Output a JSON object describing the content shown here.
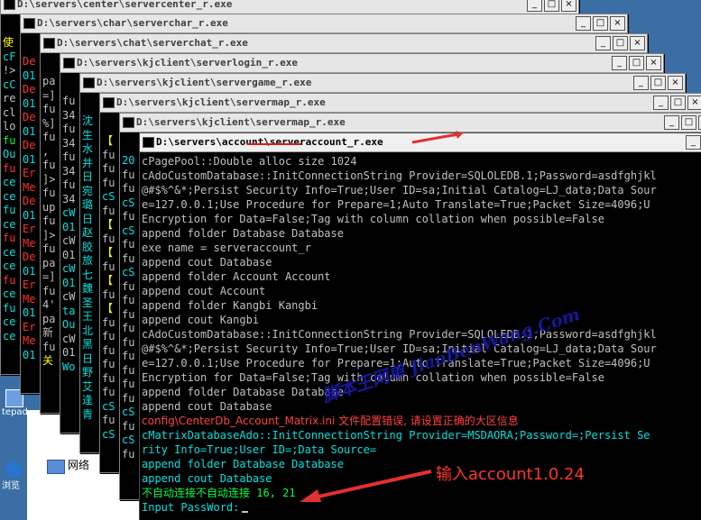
{
  "windows": [
    {
      "title": "D:\\servers\\center\\servercenter_r.exe",
      "lines": [
        {
          "t": "使",
          "c": "y"
        },
        {
          "t": "cF",
          "c": "c"
        },
        {
          "t": "!>",
          "c": "g"
        },
        {
          "t": "cC",
          "c": "c"
        },
        {
          "t": "re",
          "c": "g"
        },
        {
          "t": "cl",
          "c": "g"
        },
        {
          "t": "lo",
          "c": "g"
        },
        {
          "t": "fu",
          "c": "gr"
        },
        {
          "t": "Ou",
          "c": "c"
        },
        {
          "t": "",
          "c": "g"
        },
        {
          "t": "fu",
          "c": "r"
        },
        {
          "t": "ce",
          "c": "c"
        },
        {
          "t": "ce",
          "c": "c"
        },
        {
          "t": "fu",
          "c": "c"
        },
        {
          "t": "ce",
          "c": "c"
        },
        {
          "t": "fu",
          "c": "r"
        },
        {
          "t": "ce",
          "c": "c"
        },
        {
          "t": "ce",
          "c": "c"
        },
        {
          "t": "fu",
          "c": "r"
        },
        {
          "t": "ce",
          "c": "c"
        },
        {
          "t": "fu",
          "c": "c"
        },
        {
          "t": "ce",
          "c": "c"
        },
        {
          "t": "ce",
          "c": "c"
        }
      ]
    },
    {
      "title": "D:\\servers\\char\\serverchar_r.exe",
      "lines": [
        {
          "t": "De",
          "c": "r"
        },
        {
          "t": "01",
          "c": "c"
        },
        {
          "t": "De",
          "c": "r"
        },
        {
          "t": "01",
          "c": "c"
        },
        {
          "t": "De",
          "c": "r"
        },
        {
          "t": "01",
          "c": "c"
        },
        {
          "t": "De",
          "c": "r"
        },
        {
          "t": "01",
          "c": "c"
        },
        {
          "t": "Er",
          "c": "r"
        },
        {
          "t": "Me",
          "c": "r"
        },
        {
          "t": "De",
          "c": "r"
        },
        {
          "t": "01",
          "c": "c"
        },
        {
          "t": "Er",
          "c": "r"
        },
        {
          "t": "Me",
          "c": "r"
        },
        {
          "t": "De",
          "c": "r"
        },
        {
          "t": "01",
          "c": "c"
        },
        {
          "t": "Er",
          "c": "r"
        },
        {
          "t": "Me",
          "c": "r"
        },
        {
          "t": "01",
          "c": "c"
        },
        {
          "t": "Er",
          "c": "r"
        },
        {
          "t": "Me",
          "c": "r"
        },
        {
          "t": "01",
          "c": "c"
        }
      ]
    },
    {
      "title": "D:\\servers\\chat\\serverchat_r.exe",
      "lines": [
        {
          "t": "pa",
          "c": "g"
        },
        {
          "t": "=]",
          "c": "g"
        },
        {
          "t": "fu",
          "c": "g"
        },
        {
          "t": "%]",
          "c": "g"
        },
        {
          "t": "fu",
          "c": "g"
        },
        {
          "t": ",",
          "c": "g"
        },
        {
          "t": "fu",
          "c": "g"
        },
        {
          "t": "]>",
          "c": "g"
        },
        {
          "t": "fu",
          "c": "g"
        },
        {
          "t": "up",
          "c": "g"
        },
        {
          "t": "fu",
          "c": "g"
        },
        {
          "t": "]>",
          "c": "g"
        },
        {
          "t": "fu",
          "c": "g"
        },
        {
          "t": "pa",
          "c": "g"
        },
        {
          "t": "=]",
          "c": "g"
        },
        {
          "t": "fu",
          "c": "g"
        },
        {
          "t": "4'",
          "c": "g"
        },
        {
          "t": "pa",
          "c": "g"
        },
        {
          "t": "新",
          "c": "g"
        },
        {
          "t": "fu",
          "c": "g"
        },
        {
          "t": "关",
          "c": "y"
        }
      ]
    },
    {
      "title": "D:\\servers\\kjclient\\serverlogin_r.exe",
      "lines": [
        {
          "t": "fu",
          "c": "g"
        },
        {
          "t": "34",
          "c": "g"
        },
        {
          "t": "fu",
          "c": "g"
        },
        {
          "t": "34",
          "c": "g"
        },
        {
          "t": "fu",
          "c": "g"
        },
        {
          "t": "34",
          "c": "g"
        },
        {
          "t": "fu",
          "c": "g"
        },
        {
          "t": "34",
          "c": "g"
        },
        {
          "t": "cW",
          "c": "c"
        },
        {
          "t": "01",
          "c": "c"
        },
        {
          "t": "cW",
          "c": "g"
        },
        {
          "t": "01",
          "c": "g"
        },
        {
          "t": "cW",
          "c": "c"
        },
        {
          "t": "01",
          "c": "c"
        },
        {
          "t": "cW",
          "c": "g"
        },
        {
          "t": "ta",
          "c": "c"
        },
        {
          "t": "Ou",
          "c": "c"
        },
        {
          "t": "cW",
          "c": "g"
        },
        {
          "t": "01",
          "c": "g"
        },
        {
          "t": "Wo",
          "c": "c"
        }
      ]
    },
    {
      "title": "D:\\servers\\kjclient\\servergame_r.exe",
      "lines": [
        {
          "t": "沈",
          "c": "c"
        },
        {
          "t": "生",
          "c": "c"
        },
        {
          "t": "水",
          "c": "c"
        },
        {
          "t": "井",
          "c": "c"
        },
        {
          "t": "日",
          "c": "c"
        },
        {
          "t": "宛",
          "c": "c"
        },
        {
          "t": "璐",
          "c": "c"
        },
        {
          "t": "日",
          "c": "c"
        },
        {
          "t": "赵",
          "c": "c"
        },
        {
          "t": "胶",
          "c": "c"
        },
        {
          "t": "旅",
          "c": "c"
        },
        {
          "t": "七",
          "c": "c"
        },
        {
          "t": "魏",
          "c": "c"
        },
        {
          "t": "圣",
          "c": "c"
        },
        {
          "t": "王",
          "c": "c"
        },
        {
          "t": "北",
          "c": "c"
        },
        {
          "t": "黑",
          "c": "c"
        },
        {
          "t": "日",
          "c": "c"
        },
        {
          "t": "野",
          "c": "c"
        },
        {
          "t": "艾",
          "c": "c"
        },
        {
          "t": "逢",
          "c": "c"
        },
        {
          "t": "青",
          "c": "c"
        }
      ]
    },
    {
      "title": "D:\\servers\\kjclient\\servermap_r.exe",
      "lines": [
        {
          "t": "【",
          "c": "y"
        },
        {
          "t": "fu",
          "c": "g"
        },
        {
          "t": "fu",
          "c": "g"
        },
        {
          "t": "fu",
          "c": "g"
        },
        {
          "t": "cS",
          "c": "c"
        },
        {
          "t": "fu",
          "c": "g"
        },
        {
          "t": "【",
          "c": "y"
        },
        {
          "t": "fu",
          "c": "g"
        },
        {
          "t": "【",
          "c": "y"
        },
        {
          "t": "fu",
          "c": "g"
        },
        {
          "t": "【",
          "c": "y"
        },
        {
          "t": "fu",
          "c": "g"
        },
        {
          "t": "【",
          "c": "y"
        },
        {
          "t": "fu",
          "c": "g"
        },
        {
          "t": "fu",
          "c": "g"
        },
        {
          "t": "fu",
          "c": "g"
        },
        {
          "t": "fu",
          "c": "g"
        },
        {
          "t": "fu",
          "c": "g"
        },
        {
          "t": "fu",
          "c": "g"
        },
        {
          "t": "cS",
          "c": "c"
        },
        {
          "t": "fu",
          "c": "g"
        },
        {
          "t": "cS",
          "c": "c"
        }
      ]
    },
    {
      "title": "D:\\servers\\kjclient\\servermap_r.exe",
      "lines": [
        {
          "t": "20",
          "c": "c"
        },
        {
          "t": "fu",
          "c": "g"
        },
        {
          "t": "fu",
          "c": "g"
        },
        {
          "t": "cS",
          "c": "c"
        },
        {
          "t": "fu",
          "c": "g"
        },
        {
          "t": "cS",
          "c": "c"
        },
        {
          "t": "fu",
          "c": "g"
        },
        {
          "t": "fu",
          "c": "g"
        },
        {
          "t": "cS",
          "c": "c"
        },
        {
          "t": "fu",
          "c": "g"
        },
        {
          "t": "fu",
          "c": "g"
        },
        {
          "t": "fu",
          "c": "g"
        },
        {
          "t": "fu",
          "c": "g"
        },
        {
          "t": "fu",
          "c": "g"
        },
        {
          "t": "fu",
          "c": "g"
        },
        {
          "t": "fu",
          "c": "g"
        },
        {
          "t": "fu",
          "c": "g"
        },
        {
          "t": "fu",
          "c": "g"
        },
        {
          "t": "cS",
          "c": "c"
        },
        {
          "t": "fu",
          "c": "g"
        },
        {
          "t": "cS",
          "c": "c"
        },
        {
          "t": "fu",
          "c": "g"
        }
      ]
    }
  ],
  "main_window": {
    "title": "D:\\servers\\account\\serveraccount_r.exe",
    "lines": [
      {
        "t": "cPagePool::Double alloc size 1024",
        "c": "g"
      },
      {
        "t": "cAdoCustomDatabase::InitConnectionString Provider=SQLOLEDB.1;Password=asdfghjkl",
        "c": "g"
      },
      {
        "t": "@#$%^&*;Persist Security Info=True;User ID=sa;Initial Catalog=LJ_data;Data Sour",
        "c": "g"
      },
      {
        "t": "e=127.0.0.1;Use Procedure for Prepare=1;Auto Translate=True;Packet Size=4096;U",
        "c": "g"
      },
      {
        "t": " Encryption for Data=False;Tag with column collation when possible=False",
        "c": "g"
      },
      {
        "t": "append folder Database Database",
        "c": "g"
      },
      {
        "t": "exe name = serveraccount_r",
        "c": "g"
      },
      {
        "t": "append cout Database",
        "c": "g"
      },
      {
        "t": "append folder Account Account",
        "c": "g"
      },
      {
        "t": "append cout Account",
        "c": "g"
      },
      {
        "t": "append folder Kangbi Kangbi",
        "c": "g"
      },
      {
        "t": "append cout Kangbi",
        "c": "g"
      },
      {
        "t": "cAdoCustomDatabase::InitConnectionString Provider=SQLOLEDB.1;Password=asdfghjkl",
        "c": "g"
      },
      {
        "t": "@#$%^&*;Persist Security Info=True;User ID=sa;Initial Catalog=LJ_data;Data Sour",
        "c": "g"
      },
      {
        "t": "e=127.0.0.1;Use Procedure for Prepare=1;Auto Translate=True;Packet Size=4096;U",
        "c": "g"
      },
      {
        "t": " Encryption for Data=False;Tag with column collation when possible=False",
        "c": "g"
      },
      {
        "t": "append folder Database Database",
        "c": "g"
      },
      {
        "t": "append cout Database",
        "c": "g"
      },
      {
        "t": "config\\CenterDb_Account_Matrix.ini 文件配置错误, 请设置正确的大区信息",
        "c": "r"
      },
      {
        "t": "cMatrixDatabaseAdo::InitConnectionString Provider=MSDAORA;Password=;Persist Se",
        "c": "c"
      },
      {
        "t": "rity Info=True;User ID=;Data Source=",
        "c": "c"
      },
      {
        "t": "append folder Database Database",
        "c": "c"
      },
      {
        "t": "append cout Database",
        "c": "c"
      },
      {
        "t": "不自动连接不自动连接 16, 21",
        "c": "gr"
      },
      {
        "t": "Input PassWord:",
        "c": "c"
      }
    ]
  },
  "explorer": {
    "network_label": "网络"
  },
  "desktop_icons": [
    {
      "label": "tepad"
    },
    {
      "label": "浏览"
    }
  ],
  "annotation": {
    "note": "输入account1.0.24",
    "watermark": "脚本王网单 JiaoBenWang.Com"
  },
  "colors": {
    "desktop": "#3a6ea5",
    "arrow": "#e03030"
  }
}
